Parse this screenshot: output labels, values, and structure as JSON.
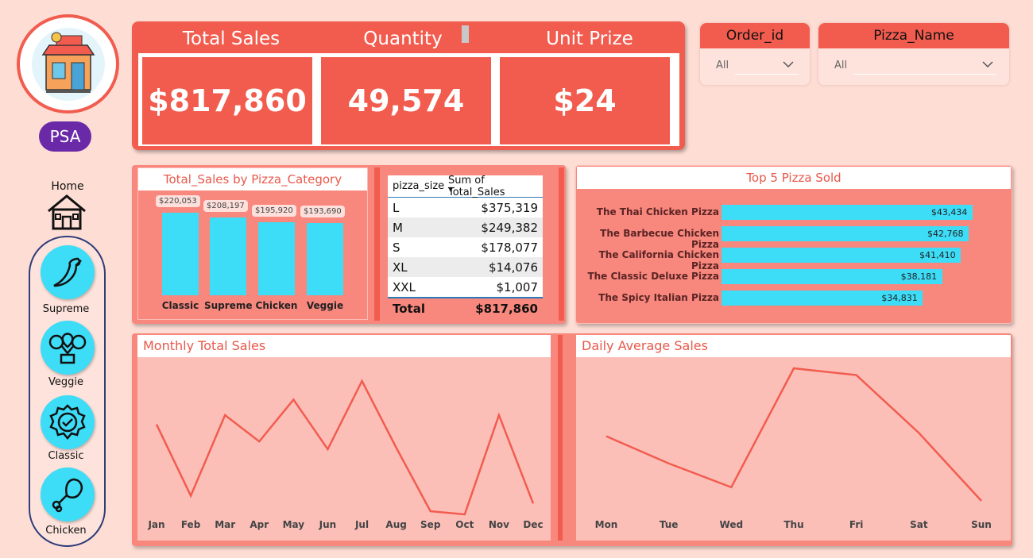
{
  "sidebar": {
    "brand_badge": "PSA",
    "home_label": "Home",
    "nav": [
      {
        "label": "Supreme",
        "icon": "chili-pepper-icon"
      },
      {
        "label": "Veggie",
        "icon": "broccoli-pot-icon"
      },
      {
        "label": "Classic",
        "icon": "badge-check-icon"
      },
      {
        "label": "Chicken",
        "icon": "chicken-leg-icon"
      }
    ]
  },
  "kpis": {
    "total_sales_title": "Total Sales",
    "quantity_title": "Quantity",
    "unit_price_title": "Unit Prize",
    "total_sales_value": "$817,860",
    "quantity_value": "49,574",
    "unit_price_value": "$24"
  },
  "slicers": {
    "order_id": {
      "title": "Order_id",
      "value": "All"
    },
    "pizza_name": {
      "title": "Pizza_Name",
      "value": "All"
    }
  },
  "category_chart": {
    "title": "Total_Sales by Pizza_Category"
  },
  "size_table": {
    "col1": "pizza_size",
    "col2": "Sum of Total_Sales",
    "rows": [
      {
        "size": "L",
        "value": "$375,319"
      },
      {
        "size": "M",
        "value": "$249,382"
      },
      {
        "size": "S",
        "value": "$178,077"
      },
      {
        "size": "XL",
        "value": "$14,076"
      },
      {
        "size": "XXL",
        "value": "$1,007"
      }
    ],
    "total_label": "Total",
    "total_value": "$817,860"
  },
  "top5_chart": {
    "title": "Top 5 Pizza Sold"
  },
  "monthly_chart": {
    "title": "Monthly Total Sales"
  },
  "daily_chart": {
    "title": "Daily Average Sales"
  },
  "colors": {
    "accent": "#f25c4f",
    "bar": "#3ddcf7",
    "purple": "#6a2aa8"
  },
  "chart_data": [
    {
      "type": "bar",
      "title": "Total_Sales by Pizza_Category",
      "categories": [
        "Classic",
        "Supreme",
        "Chicken",
        "Veggie"
      ],
      "values": [
        220053,
        208197,
        195920,
        193690
      ],
      "labels": [
        "$220,053",
        "$208,197",
        "$195,920",
        "$193,690"
      ]
    },
    {
      "type": "bar",
      "title": "Top 5 Pizza Sold",
      "orientation": "horizontal",
      "categories": [
        "The Thai Chicken Pizza",
        "The Barbecue Chicken Pizza",
        "The California Chicken Pizza",
        "The Classic Deluxe Pizza",
        "The Spicy Italian Pizza"
      ],
      "values": [
        43434,
        42768,
        41410,
        38181,
        34831
      ],
      "labels": [
        "$43,434",
        "$42,768",
        "$41,410",
        "$38,181",
        "$34,831"
      ]
    },
    {
      "type": "line",
      "title": "Monthly Total Sales",
      "categories": [
        "Jan",
        "Feb",
        "Mar",
        "Apr",
        "May",
        "Jun",
        "Jul",
        "Aug",
        "Sep",
        "Oct",
        "Nov",
        "Dec"
      ],
      "values": [
        69800,
        65200,
        70400,
        68700,
        71400,
        68200,
        72600,
        68300,
        64200,
        64000,
        70400,
        64700
      ]
    },
    {
      "type": "line",
      "title": "Daily Average Sales",
      "categories": [
        "Mon",
        "Tue",
        "Wed",
        "Thu",
        "Fri",
        "Sat",
        "Sun"
      ],
      "values": [
        14280,
        14200,
        14130,
        14480,
        14460,
        14290,
        14090
      ]
    }
  ]
}
